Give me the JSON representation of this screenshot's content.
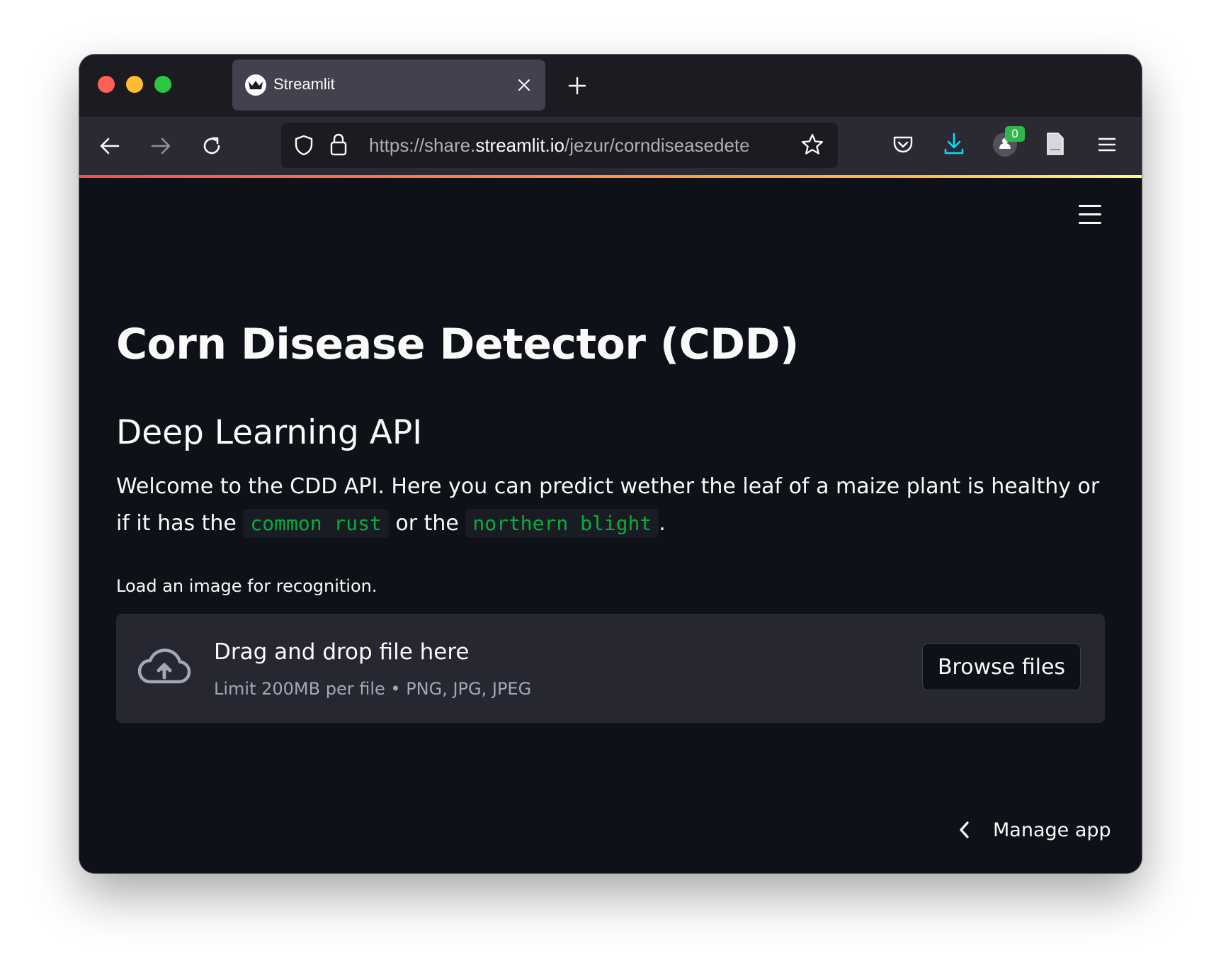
{
  "browser": {
    "tab_title": "Streamlit",
    "url_prefix": "https://share.",
    "url_host": "streamlit.io",
    "url_path": "/jezur/corndiseasedete",
    "extension_badge": "0"
  },
  "app": {
    "title": "Corn Disease Detector (CDD)",
    "subtitle": "Deep Learning API",
    "intro_before": "Welcome to the CDD API. Here you can predict wether the leaf of a maize plant is healthy or if it has the ",
    "code_1": "common rust",
    "intro_middle": " or the ",
    "code_2": "northern blight",
    "intro_after": ".",
    "uploader_label": "Load an image for recognition.",
    "dropzone_title": "Drag and drop file here",
    "dropzone_limit": "Limit 200MB per file • PNG, JPG, JPEG",
    "browse_label": "Browse files",
    "manage_label": "Manage app"
  },
  "colors": {
    "app_background": "#0e1117",
    "dropzone_background": "#262730",
    "code_text": "#09ab3b",
    "accent_line_start": "#ff4b4b",
    "accent_line_end": "#fffd80"
  }
}
